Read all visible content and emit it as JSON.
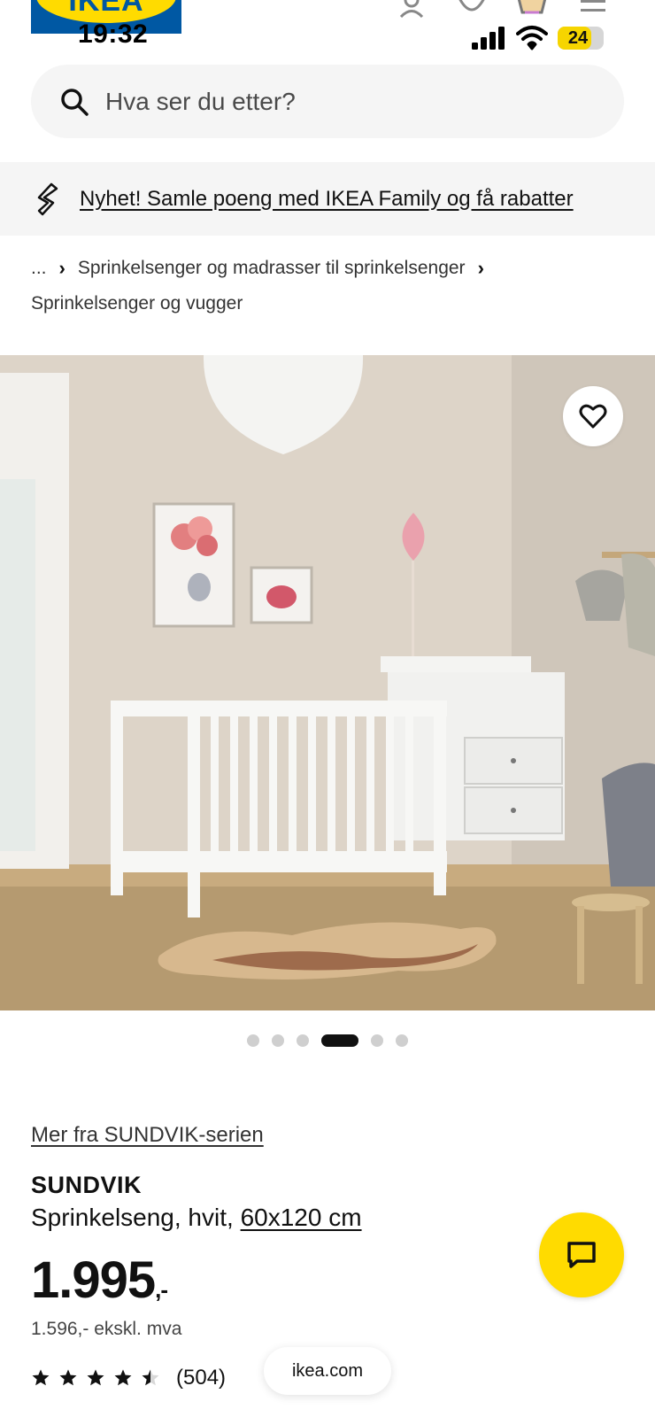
{
  "brand": {
    "logo_text": "IKEA",
    "blue": "#0058a3",
    "yellow": "#ffdb00"
  },
  "status_bar": {
    "time": "19:32",
    "battery": "24"
  },
  "header_icons": [
    "user-icon",
    "heart-icon",
    "cart-icon",
    "menu-icon"
  ],
  "search": {
    "placeholder": "Hva ser du etter?"
  },
  "banner": {
    "text": "Nyhet! Samle poeng med IKEA Family og få rabatter"
  },
  "breadcrumb": {
    "ellipsis": "...",
    "items": [
      "Sprinkelsenger og madrasser til sprinkelsenger",
      "Sprinkelsenger og vugger"
    ]
  },
  "gallery": {
    "image_count": 6,
    "active_index": 3
  },
  "product": {
    "series_link": "Mer fra SUNDVIK-serien",
    "name": "SUNDVIK",
    "desc_prefix": "Sprinkelseng, hvit, ",
    "size": "60x120 cm",
    "price": "1.995",
    "price_suffix": ",-",
    "price_ex_vat": "1.596,- ekskl. mva",
    "rating": 4.5,
    "review_count": "(504)"
  },
  "url_pill": "ikea.com"
}
